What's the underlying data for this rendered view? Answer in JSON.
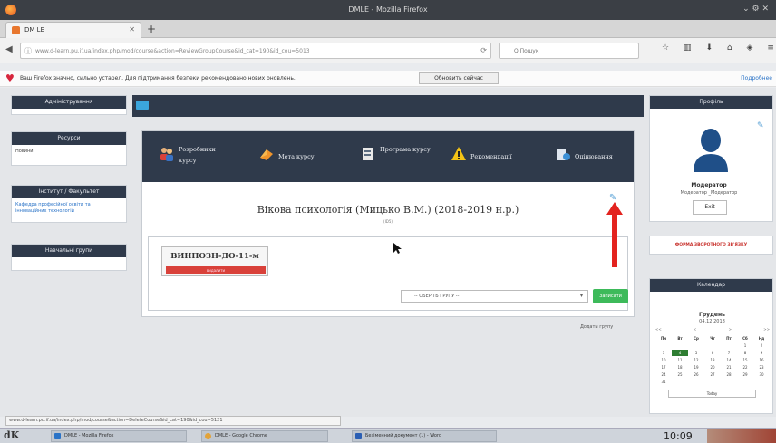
{
  "window": {
    "title": "DMLE - Mozilla Firefox",
    "controls": "⌄ ⚙ ✕"
  },
  "tab": {
    "title": "DM LE"
  },
  "nav": {
    "url": "www.d-learn.pu.if.ua/index.php/mod/course&action=ReviewGroupCourse&id_cat=190&id_cou=5013",
    "search_placeholder": "Q Пошук"
  },
  "notification": {
    "text": "Ваш Firefox значно, сильно устарел. Для підтримання безпеки рекомендовано нових оновлень.",
    "button": "Обновить сейчас",
    "link": "Подробнее"
  },
  "left_blocks": [
    {
      "title": "Адміністрування",
      "body": ""
    },
    {
      "title": "Ресурси",
      "body": "Новини"
    },
    {
      "title": "Інститут / Факультет",
      "body": "Кафедра професійної освіти та інноваційних технологій"
    },
    {
      "title": "Навчальні групи",
      "body": ""
    }
  ],
  "course_menu": [
    {
      "label": "Розробники курсу",
      "icon": "users-icon"
    },
    {
      "label": "Мета курсу",
      "icon": "target-icon"
    },
    {
      "label": "Програма курсу",
      "icon": "program-icon"
    },
    {
      "label": "Рекомендації",
      "icon": "warning-icon"
    },
    {
      "label": "Оцінювання",
      "icon": "grades-icon"
    }
  ],
  "course": {
    "title": "Вікова психологія (Мицько В.М.) (2018-2019 н.р.)",
    "subtitle": "(ID5)"
  },
  "groups": [
    {
      "name": "ВИНПОЗН-ДО-11-м",
      "delete_label": "видалити"
    }
  ],
  "group_select": {
    "value": "-- ОБЕРІТЬ ГРУПУ --",
    "save": "Записати"
  },
  "add_group_link": "Додати групу",
  "profile": {
    "title": "Профіль",
    "name": "Модератор",
    "role": "Модератор _Модератор",
    "exit": "Exit"
  },
  "feedback": "ФОРМА ЗВОРОТНОГО ЗВ'ЯЗКУ",
  "calendar": {
    "title": "Календар",
    "month": "Грудень",
    "date": "04.12.2018",
    "nav": [
      "<<",
      "<",
      ">",
      ">>"
    ],
    "weekdays": [
      "Пн",
      "Вт",
      "Ср",
      "Чт",
      "Пт",
      "Сб",
      "Нд"
    ],
    "days": [
      "",
      "",
      "",
      "",
      "",
      "1",
      "2",
      "3",
      "4",
      "5",
      "6",
      "7",
      "8",
      "9",
      "10",
      "11",
      "12",
      "13",
      "14",
      "15",
      "16",
      "17",
      "18",
      "19",
      "20",
      "21",
      "22",
      "23",
      "24",
      "25",
      "26",
      "27",
      "28",
      "29",
      "30",
      "31",
      "",
      "",
      "",
      "",
      "",
      ""
    ],
    "today_label": "Today",
    "today_day": "4"
  },
  "statusbar": "www.d-learn.pu.if.ua/index.php/mod/course&action=DeleteCourse&id_cat=190&id_cou=5121",
  "taskbar": {
    "start": "dK",
    "tasks": [
      "DMLE - Mozilla Firefox",
      "DMLE - Google Chrome",
      "Безіменний документ (1) - Word"
    ],
    "clock": "10:09"
  },
  "colors": {
    "dark_header": "#2f3a4b",
    "delete_red": "#d9413a",
    "save_green": "#3dba5a",
    "annotation_arrow": "#e3231f"
  }
}
